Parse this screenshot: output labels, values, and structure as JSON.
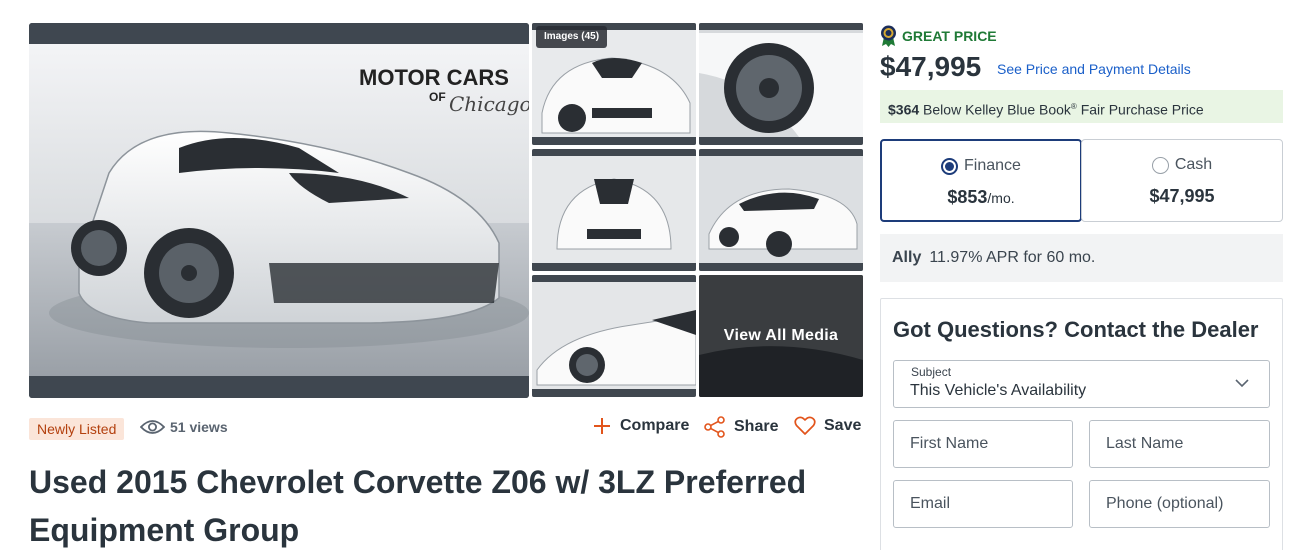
{
  "gallery": {
    "images_count": "Images (45)",
    "view_all": "View All Media",
    "dealer_logo_text": "MOTOR CARS",
    "dealer_logo_of": "OF",
    "dealer_logo_script": "Chicago"
  },
  "listing": {
    "badge": "Newly Listed",
    "views": "51 views",
    "actions": {
      "compare": "Compare",
      "share": "Share",
      "save": "Save"
    },
    "title": "Used 2015 Chevrolet Corvette Z06 w/ 3LZ Preferred Equipment Group"
  },
  "pricing": {
    "rating": "GREAT PRICE",
    "price": "$47,995",
    "details_link": "See Price and Payment Details",
    "kbb_amount": "$364",
    "kbb_text_1": "Below Kelley Blue Book",
    "kbb_reg": "®",
    "kbb_text_2": "Fair Purchase Price",
    "finance": {
      "label": "Finance",
      "amount": "$853",
      "unit": "/mo."
    },
    "cash": {
      "label": "Cash",
      "amount": "$47,995"
    },
    "lender": "Ally",
    "apr_text": "11.97% APR for 60 mo."
  },
  "contact": {
    "heading": "Got Questions? Contact the Dealer",
    "subject_label": "Subject",
    "subject_value": "This Vehicle's Availability",
    "first_name_placeholder": "First Name",
    "last_name_placeholder": "Last Name",
    "email_placeholder": "Email",
    "phone_placeholder": "Phone (optional)"
  },
  "colors": {
    "great_price": "#1f7a36",
    "link": "#1a5fc9",
    "selected": "#1d3c7a",
    "compare_icon": "#e2541b",
    "badge_bg": "#fbe5d9",
    "kbb_bg": "#e9f5e4"
  },
  "icons": [
    "great-price-ribbon-icon",
    "eye-icon",
    "plus-icon",
    "share-icon",
    "heart-icon",
    "chevron-down-icon"
  ]
}
